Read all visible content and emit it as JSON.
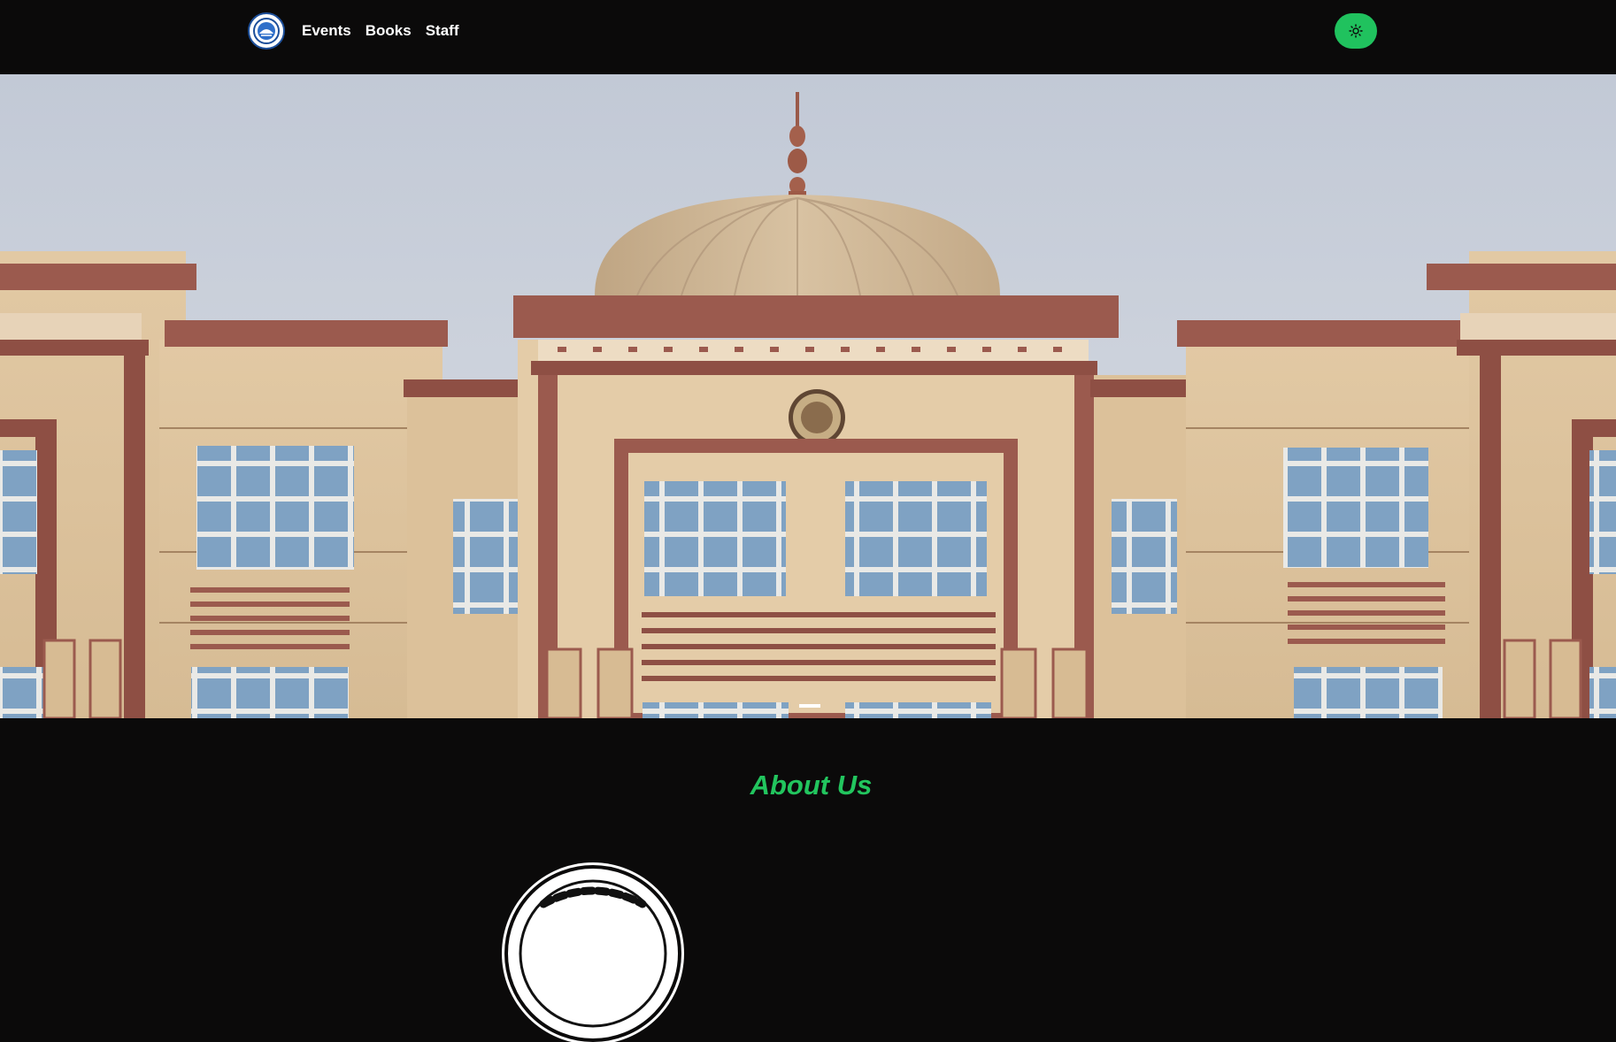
{
  "nav": {
    "logo_icon": "university-logo-icon",
    "links": [
      {
        "label": "Events"
      },
      {
        "label": "Books"
      },
      {
        "label": "Staff"
      }
    ],
    "theme_toggle_icon": "sun-icon"
  },
  "hero": {
    "image": "university-building-dome-photo",
    "active_slide": 1,
    "slide_count": 1
  },
  "about": {
    "title": "About Us",
    "seal_icon": "university-seal-icon"
  },
  "colors": {
    "accent": "#22c55e",
    "toggle_bg": "#20c25e",
    "background": "#0b0a0a",
    "nav_text": "#ffffff"
  }
}
